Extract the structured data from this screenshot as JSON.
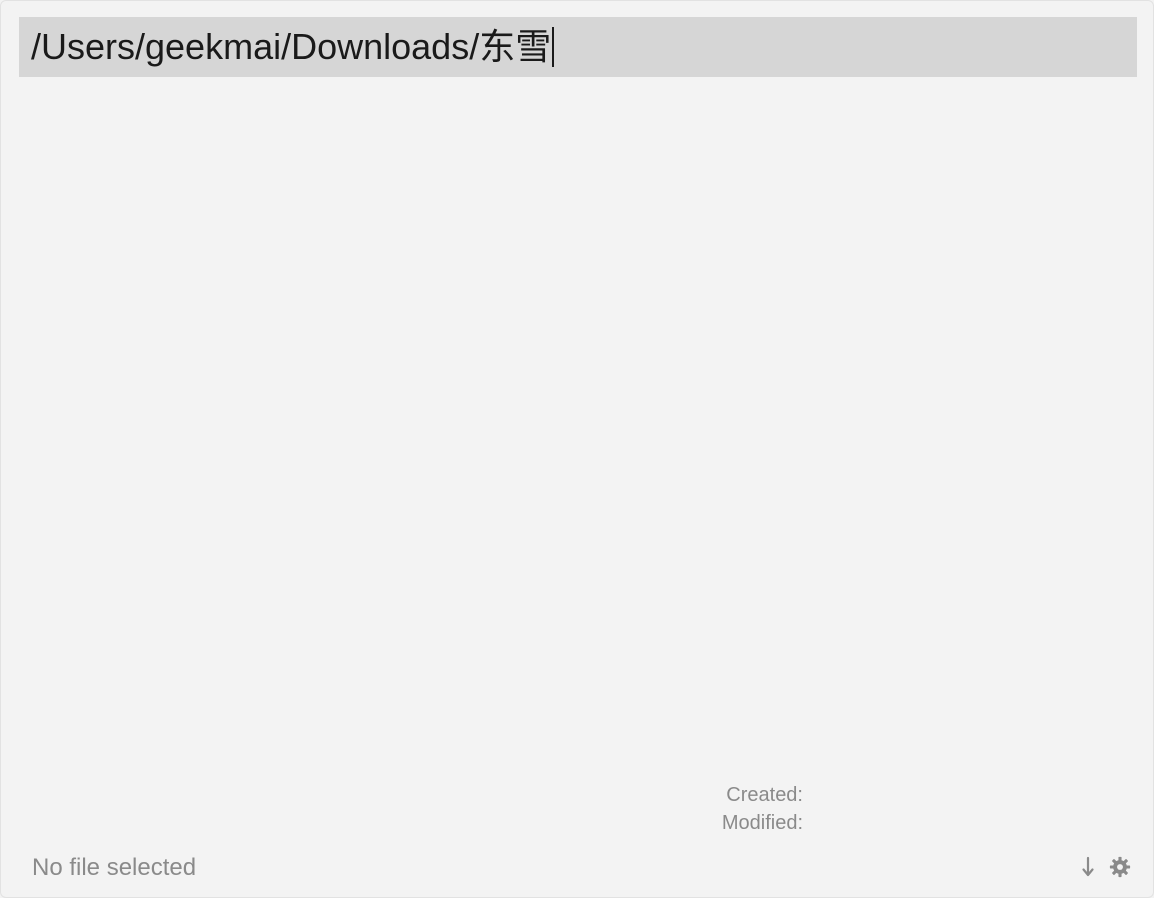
{
  "search": {
    "value": "/Users/geekmai/Downloads/东雪"
  },
  "details": {
    "created_label": "Created:",
    "modified_label": "Modified:"
  },
  "footer": {
    "status": "No file selected",
    "icons": [
      "sort-down-arrow-icon",
      "gear-icon"
    ]
  },
  "colors": {
    "background": "#f3f3f3",
    "search_bar": "#d6d6d6",
    "muted_text": "#8a8a8a",
    "input_text": "#1a1a1a"
  }
}
